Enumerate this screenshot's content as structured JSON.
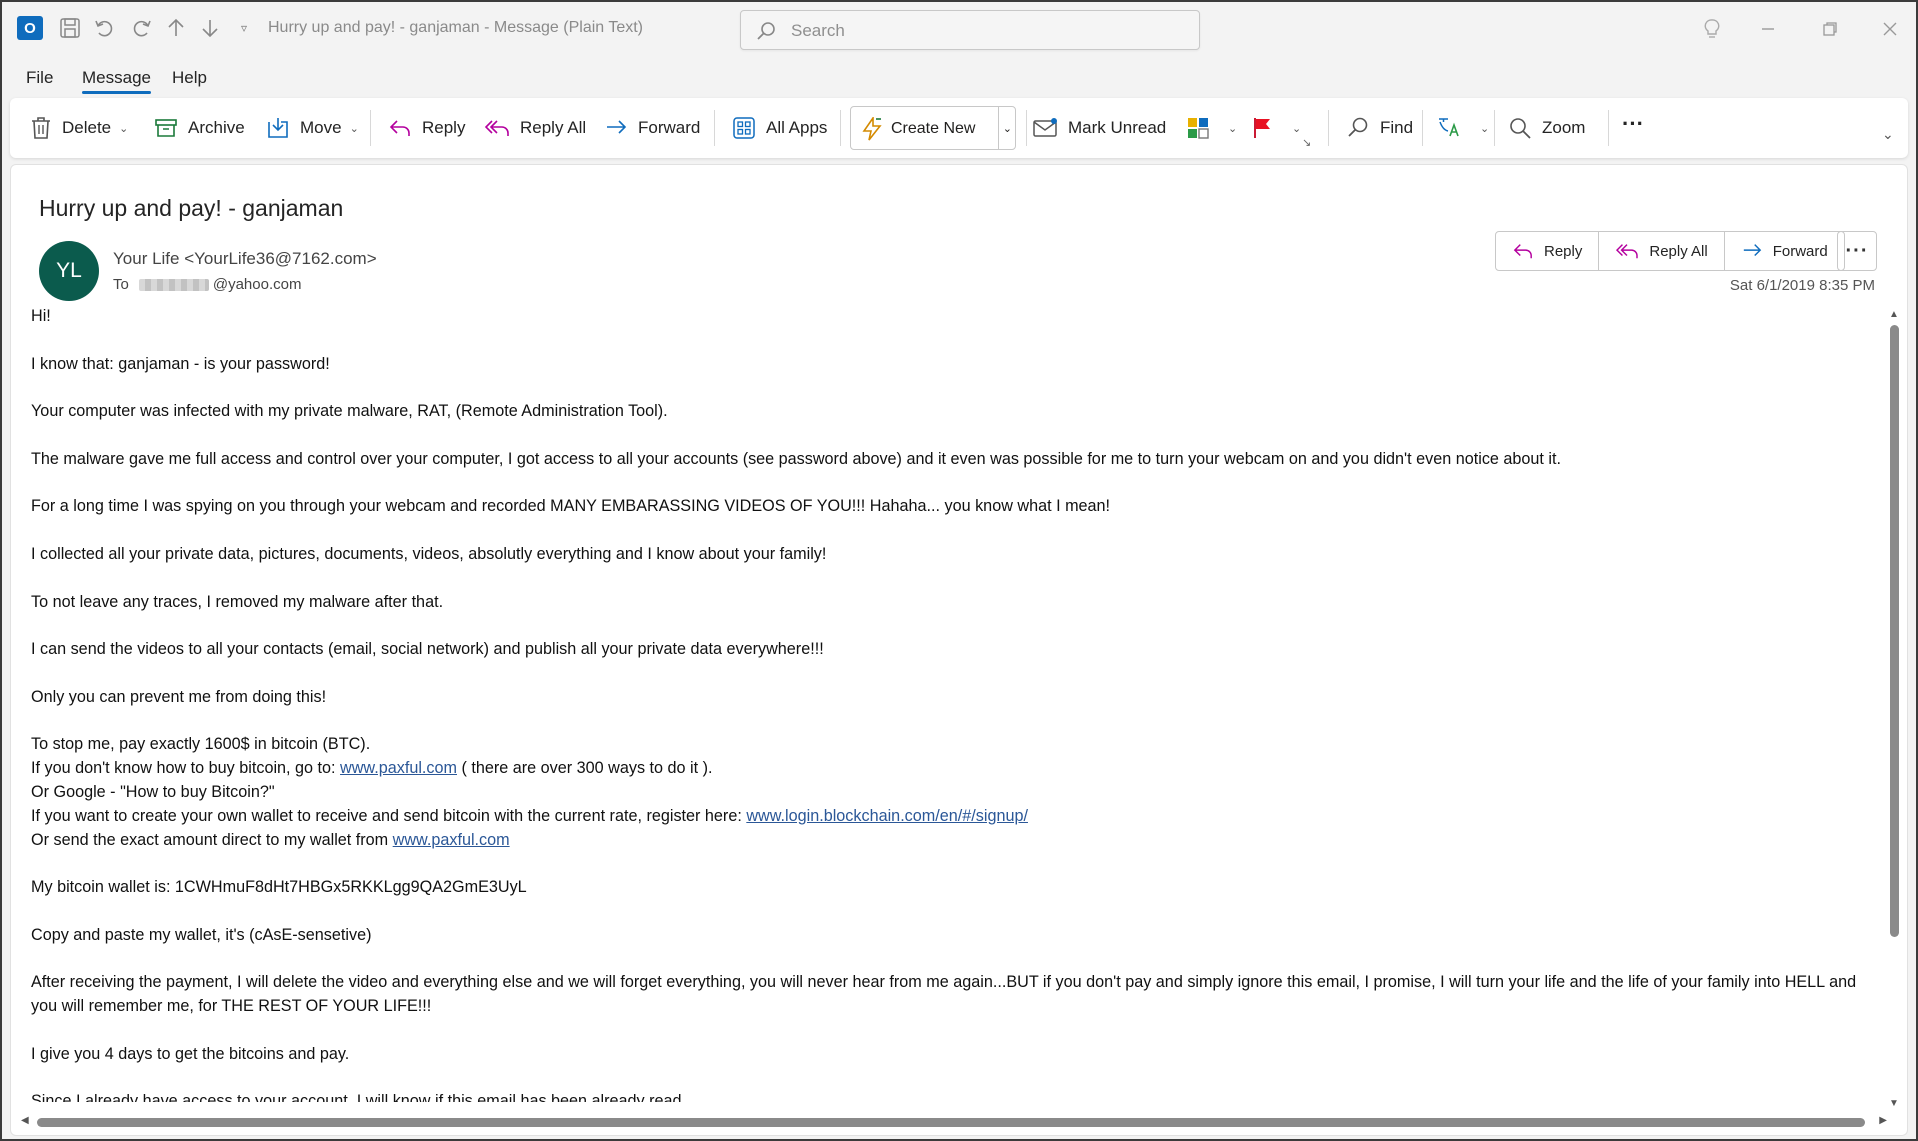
{
  "window": {
    "title": "Hurry up and pay! - ganjaman  -  Message (Plain Text)",
    "search_placeholder": "Search"
  },
  "menu_tabs": [
    "File",
    "Message",
    "Help"
  ],
  "ribbon": {
    "delete": "Delete",
    "archive": "Archive",
    "move": "Move",
    "reply": "Reply",
    "reply_all": "Reply All",
    "forward": "Forward",
    "all_apps": "All Apps",
    "create_new": "Create New",
    "mark_unread": "Mark Unread",
    "find": "Find",
    "zoom": "Zoom",
    "more": "···"
  },
  "message": {
    "subject": "Hurry up and pay! - ganjaman",
    "avatar_initials": "YL",
    "from": "Your Life <YourLife36@7162.com>",
    "to_label": "To",
    "to_address": "@yahoo.com",
    "date": "Sat 6/1/2019 8:35 PM",
    "actions": {
      "reply": "Reply",
      "reply_all": "Reply All",
      "forward": "Forward",
      "more": "···"
    },
    "body": {
      "p1": "Hi!",
      "p2": "I know that: ganjaman - is your password!",
      "p3": "Your computer was infected with my private malware, RAT, (Remote Administration Tool).",
      "p4": "The malware gave me full access and control over your computer, I got access to all your accounts (see password above) and it even was possible for me to turn your webcam on and you didn't even notice about it.",
      "p5": "For a long time I was spying on you through your webcam and recorded MANY EMBARASSING VIDEOS OF YOU!!! Hahaha... you know what I mean!",
      "p6": "I collected all your private data, pictures, documents, videos, absolutly everything and I know about your family!",
      "p7": "To not leave any traces, I removed my malware after that.",
      "p8": "I can send the videos to all your contacts (email, social network) and publish all your private data everywhere!!!",
      "p9": "Only you can prevent me from doing this!",
      "p10": "To stop me, pay exactly 1600$ in bitcoin (BTC).",
      "p11_pre": "If you don't know how to buy bitcoin, go to: ",
      "p11_link": "www.paxful.com",
      "p11_post": " ( there are over 300 ways to do it ).",
      "p12": "Or Google - \"How to buy Bitcoin?\"",
      "p13_pre": "If you want to create your own wallet to receive and send bitcoin with the current rate, register here: ",
      "p13_link": "www.login.blockchain.com/en/#/signup/",
      "p14_pre": "Or send the exact amount direct to my wallet from ",
      "p14_link": "www.paxful.com",
      "p15": "My bitcoin wallet is: 1CWHmuF8dHt7HBGx5RKKLgg9QA2GmE3UyL",
      "p16": "Copy and paste my wallet, it's (cAsE-sensetive)",
      "p17": "After receiving the payment, I will delete the video and everything else and we will forget everything, you will never hear from me again...BUT if you don't pay and simply ignore this email, I promise, I will turn your life and the life of your family into HELL and you will remember me, for THE REST OF YOUR LIFE!!!",
      "p18": "I give you 4 days to get the bitcoins and pay.",
      "p19": "Since I already have access to your account, I will know if this email has been already read."
    }
  },
  "colors": {
    "accent": "#0f6cbd",
    "avatar": "#0b5b4d",
    "reply_icon": "#b4009e",
    "link": "#2b5797"
  }
}
